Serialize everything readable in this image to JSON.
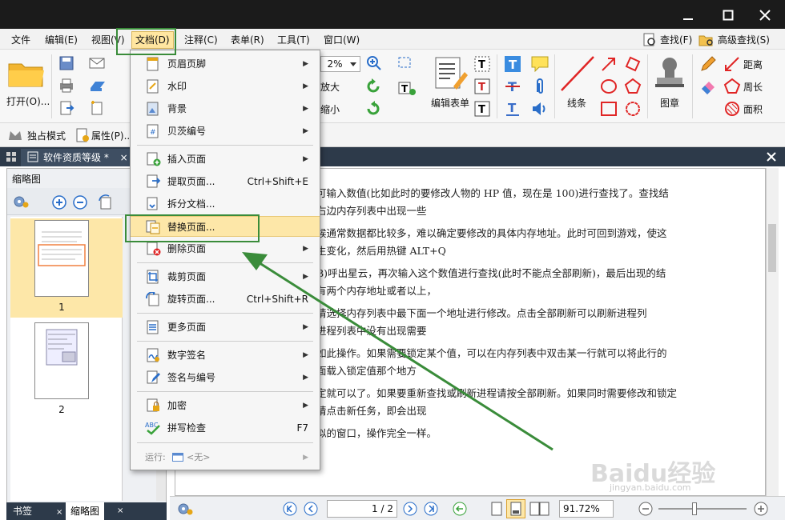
{
  "menubar": {
    "items": [
      "文件",
      "编辑(E)",
      "视图(V)",
      "文档(D)",
      "注释(C)",
      "表单(R)",
      "工具(T)",
      "窗口(W)"
    ],
    "find": "查找(F)",
    "advanced_find": "高级查找(S)"
  },
  "ribbon": {
    "open": "打开(O)...",
    "zoom_value": "2%",
    "enlarge": "放大",
    "shrink": "缩小",
    "edit_form": "编辑表单",
    "line": "线条",
    "stamp": "图章",
    "distance": "距离",
    "perimeter": "周长",
    "area": "面积"
  },
  "subbar": {
    "exclusive_mode": "独占模式",
    "properties": "属性(P)..."
  },
  "doc_tab": {
    "title": "软件资质等级 *",
    "close": "×"
  },
  "left_panel": {
    "title": "缩略图",
    "pages": [
      "1",
      "2"
    ],
    "tabs": [
      "书签",
      "缩略图"
    ]
  },
  "dropdown": {
    "items": [
      {
        "label": "页眉页脚",
        "shortcut": "",
        "arrow": "▶"
      },
      {
        "label": "水印",
        "shortcut": "",
        "arrow": "▶"
      },
      {
        "label": "背景",
        "shortcut": "",
        "arrow": "▶"
      },
      {
        "label": "贝茨编号",
        "shortcut": "",
        "arrow": "▶"
      },
      {
        "label": "插入页面",
        "shortcut": "",
        "arrow": "▶"
      },
      {
        "label": "提取页面...",
        "shortcut": "Ctrl+Shift+E",
        "arrow": ""
      },
      {
        "label": "拆分文档...",
        "shortcut": "",
        "arrow": ""
      },
      {
        "label": "替换页面...",
        "shortcut": "",
        "arrow": ""
      },
      {
        "label": "删除页面",
        "shortcut": "",
        "arrow": "▶"
      },
      {
        "label": "裁剪页面",
        "shortcut": "",
        "arrow": "▶"
      },
      {
        "label": "旋转页面...",
        "shortcut": "Ctrl+Shift+R",
        "arrow": ""
      },
      {
        "label": "更多页面",
        "shortcut": "",
        "arrow": "▶"
      },
      {
        "label": "数字签名",
        "shortcut": "",
        "arrow": "▶"
      },
      {
        "label": "签名与编号",
        "shortcut": "",
        "arrow": "▶"
      },
      {
        "label": "加密",
        "shortcut": "",
        "arrow": "▶"
      },
      {
        "label": "拼写检查",
        "shortcut": "F7",
        "arrow": ""
      }
    ],
    "run_label": "运行:",
    "run_value": "<无>",
    "spell_icon_text": "ABC"
  },
  "document_lines": [
    "可输入数值(比如此时的要修改人物的 HP 值，现在是 100)进行查找了。查找结",
    "右边内存列表中出现一些",
    "候通常数据都比较多，难以确定要修改的具体内存地址。此时可回到游戏，使这",
    "生变化，然后用热键 ALT+Q",
    "B)呼出星云，再次输入这个数值进行查找(此时不能点全部刷新)，最后出现的结",
    "有两个内存地址或者以上，",
    "请选择内存列表中最下面一个地址进行修改。点击全部刷新可以刷新进程列",
    "进程列表中没有出现需要",
    "如此操作。如果需要锁定某个值，可以在内存列表中双击某一行就可以将此行的",
    "面载入锁定值那个地方",
    "定就可以了。如果要重新查找或刷新进程请按全部刷新。如果同时需要修改和锁定",
    "请点击新任务，即会出现",
    "似的窗口，操作完全一样。"
  ],
  "statusbar": {
    "page": "1 / 2",
    "zoom": "91.72%"
  },
  "watermark": {
    "text": "Baidu经验",
    "url": "jingyan.baidu.com"
  },
  "colors": {
    "highlight": "#fde7a8",
    "annotation_green": "#3a8c3a",
    "tab_bar": "#2d3a4a"
  }
}
